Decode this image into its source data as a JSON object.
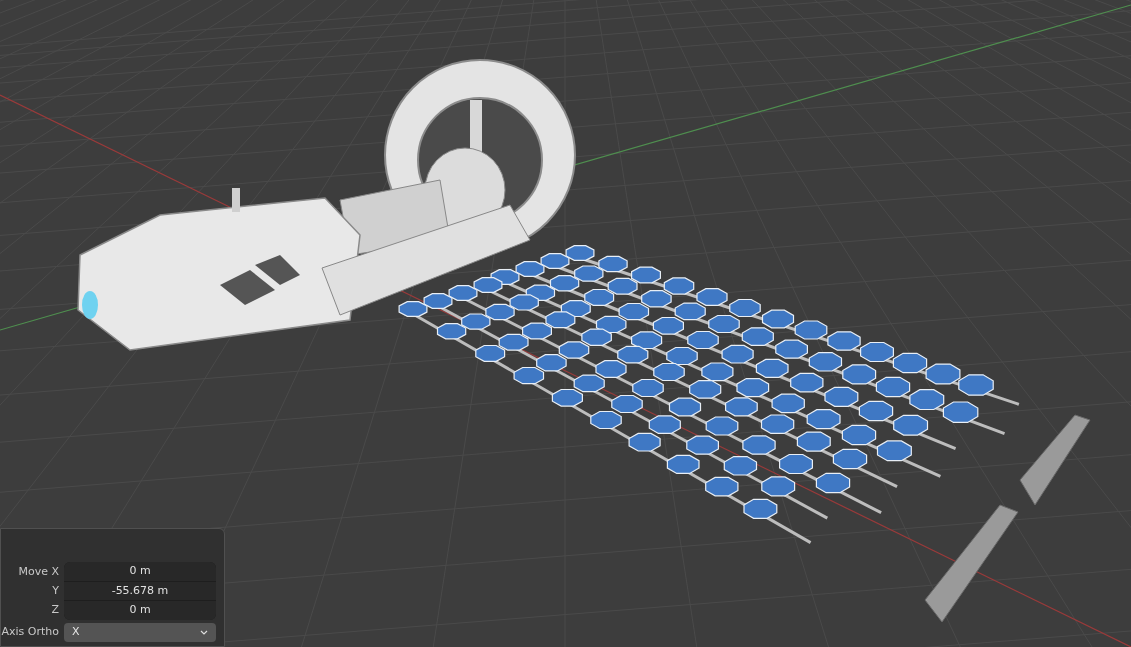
{
  "operator_panel": {
    "fields": [
      {
        "label": "Move X",
        "value": "0 m"
      },
      {
        "label": "Y",
        "value": "-55.678 m"
      },
      {
        "label": "Z",
        "value": "0 m"
      }
    ],
    "axis_ortho": {
      "label": "Axis Ortho",
      "value": "X"
    }
  }
}
